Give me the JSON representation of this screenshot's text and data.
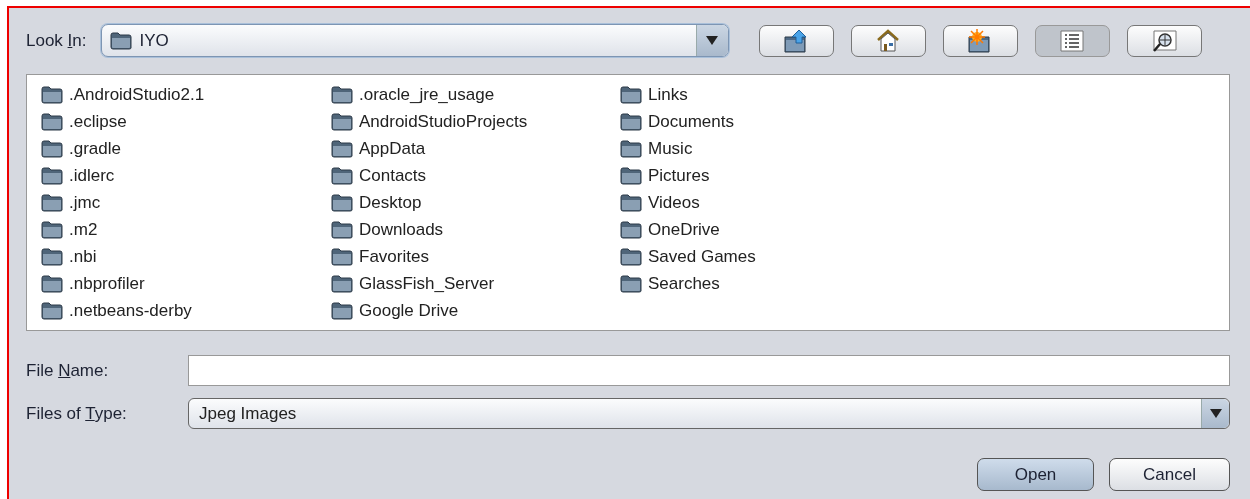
{
  "look_in": {
    "label_before": "Look ",
    "label_key": "I",
    "label_after": "n:",
    "value": "IYO"
  },
  "toolbar": [
    {
      "kind": "up",
      "selected": false
    },
    {
      "kind": "home",
      "selected": false
    },
    {
      "kind": "newfolder",
      "selected": false
    },
    {
      "kind": "list",
      "selected": true
    },
    {
      "kind": "details",
      "selected": false
    }
  ],
  "files": [
    ".AndroidStudio2.1",
    ".eclipse",
    ".gradle",
    ".idlerc",
    ".jmc",
    ".m2",
    ".nbi",
    ".nbprofiler",
    ".netbeans-derby",
    ".oracle_jre_usage",
    "AndroidStudioProjects",
    "AppData",
    "Contacts",
    "Desktop",
    "Downloads",
    "Favorites",
    "GlassFish_Server",
    "Google Drive",
    "Links",
    "Documents",
    "Music",
    "Pictures",
    "Videos",
    "OneDrive",
    "Saved Games",
    "Searches"
  ],
  "file_name": {
    "label_before": "File ",
    "label_key": "N",
    "label_after": "ame:"
  },
  "file_type": {
    "label_before": "Files of ",
    "label_key": "T",
    "label_after": "ype:",
    "value": "Jpeg Images"
  },
  "buttons": [
    {
      "label": "Open",
      "kind": "default"
    },
    {
      "label": "Cancel",
      "kind": "normal"
    }
  ]
}
